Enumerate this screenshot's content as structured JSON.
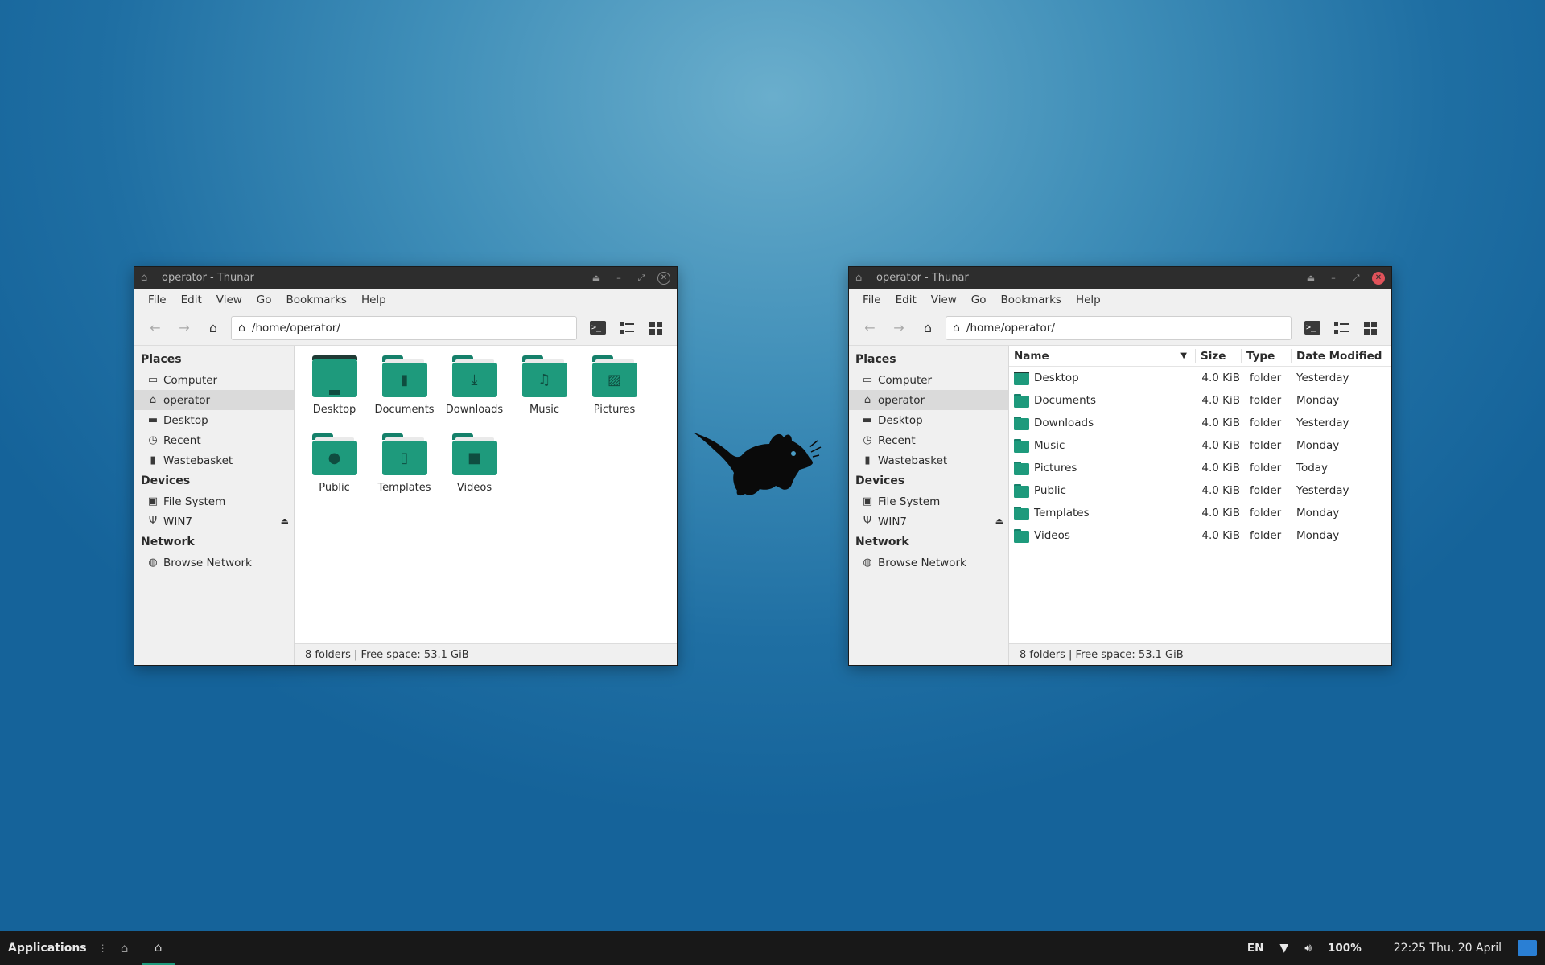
{
  "left_window": {
    "title": "operator - Thunar",
    "menu": [
      "File",
      "Edit",
      "View",
      "Go",
      "Bookmarks",
      "Help"
    ],
    "location": "/home/operator/",
    "sidebar": {
      "places_title": "Places",
      "places": [
        "Computer",
        "operator",
        "Desktop",
        "Recent",
        "Wastebasket"
      ],
      "devices_title": "Devices",
      "devices": [
        "File System",
        "WIN7"
      ],
      "network_title": "Network",
      "network": [
        "Browse Network"
      ]
    },
    "icons": [
      "Desktop",
      "Documents",
      "Downloads",
      "Music",
      "Pictures",
      "Public",
      "Templates",
      "Videos"
    ],
    "status": "8 folders  |  Free space: 53.1 GiB"
  },
  "right_window": {
    "title": "operator - Thunar",
    "menu": [
      "File",
      "Edit",
      "View",
      "Go",
      "Bookmarks",
      "Help"
    ],
    "location": "/home/operator/",
    "sidebar": {
      "places_title": "Places",
      "places": [
        "Computer",
        "operator",
        "Desktop",
        "Recent",
        "Wastebasket"
      ],
      "devices_title": "Devices",
      "devices": [
        "File System",
        "WIN7"
      ],
      "network_title": "Network",
      "network": [
        "Browse Network"
      ]
    },
    "columns": {
      "name": "Name",
      "size": "Size",
      "type": "Type",
      "date": "Date Modified"
    },
    "rows": [
      {
        "name": "Desktop",
        "size": "4.0 KiB",
        "type": "folder",
        "date": "Yesterday"
      },
      {
        "name": "Documents",
        "size": "4.0 KiB",
        "type": "folder",
        "date": "Monday"
      },
      {
        "name": "Downloads",
        "size": "4.0 KiB",
        "type": "folder",
        "date": "Yesterday"
      },
      {
        "name": "Music",
        "size": "4.0 KiB",
        "type": "folder",
        "date": "Monday"
      },
      {
        "name": "Pictures",
        "size": "4.0 KiB",
        "type": "folder",
        "date": "Today"
      },
      {
        "name": "Public",
        "size": "4.0 KiB",
        "type": "folder",
        "date": "Yesterday"
      },
      {
        "name": "Templates",
        "size": "4.0 KiB",
        "type": "folder",
        "date": "Monday"
      },
      {
        "name": "Videos",
        "size": "4.0 KiB",
        "type": "folder",
        "date": "Monday"
      }
    ],
    "status": "8 folders  |  Free space: 53.1 GiB"
  },
  "taskbar": {
    "applications": "Applications",
    "language": "EN",
    "volume": "100%",
    "clock": "22:25 Thu, 20 April"
  },
  "colors": {
    "folder": "#1e9a7c",
    "accent": "#1e9a7c",
    "close_active": "#e0525a"
  }
}
